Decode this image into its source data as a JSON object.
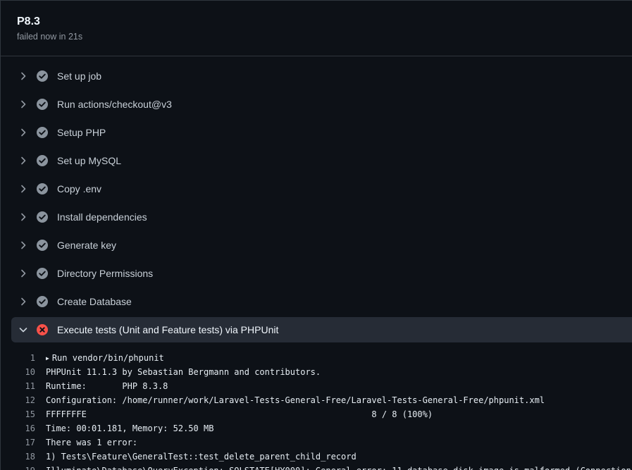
{
  "job": {
    "title": "P8.3",
    "status": "failed now in 21s"
  },
  "colors": {
    "success": "#8b949e",
    "failure": "#f85149",
    "background": "#0d1117",
    "expanded_row": "#262c36"
  },
  "steps": [
    {
      "label": "Set up job",
      "status": "success",
      "icon": "check-circle-icon",
      "expanded": false
    },
    {
      "label": "Run actions/checkout@v3",
      "status": "success",
      "icon": "check-circle-icon",
      "expanded": false
    },
    {
      "label": "Setup PHP",
      "status": "success",
      "icon": "check-circle-icon",
      "expanded": false
    },
    {
      "label": "Set up MySQL",
      "status": "success",
      "icon": "check-circle-icon",
      "expanded": false
    },
    {
      "label": "Copy .env",
      "status": "success",
      "icon": "check-circle-icon",
      "expanded": false
    },
    {
      "label": "Install dependencies",
      "status": "success",
      "icon": "check-circle-icon",
      "expanded": false
    },
    {
      "label": "Generate key",
      "status": "success",
      "icon": "check-circle-icon",
      "expanded": false
    },
    {
      "label": "Directory Permissions",
      "status": "success",
      "icon": "check-circle-icon",
      "expanded": false
    },
    {
      "label": "Create Database",
      "status": "success",
      "icon": "check-circle-icon",
      "expanded": false
    },
    {
      "label": "Execute tests (Unit and Feature tests) via PHPUnit",
      "status": "failure",
      "icon": "x-circle-icon",
      "expanded": true
    }
  ],
  "log": [
    {
      "n": "1",
      "text": "Run vendor/bin/phpunit",
      "collapsible": true
    },
    {
      "n": "10",
      "text": "PHPUnit 11.1.3 by Sebastian Bergmann and contributors."
    },
    {
      "n": "11",
      "text": "Runtime:       PHP 8.3.8"
    },
    {
      "n": "12",
      "text": "Configuration: /home/runner/work/Laravel-Tests-General-Free/Laravel-Tests-General-Free/phpunit.xml"
    },
    {
      "n": "15",
      "text": "FFFFFFFE                                                        8 / 8 (100%)"
    },
    {
      "n": "16",
      "text": "Time: 00:01.181, Memory: 52.50 MB"
    },
    {
      "n": "17",
      "text": "There was 1 error:"
    },
    {
      "n": "18",
      "text": "1) Tests\\Feature\\GeneralTest::test_delete_parent_child_record"
    },
    {
      "n": "19",
      "text": "Illuminate\\Database\\QueryException: SQLSTATE[HY000]: General error: 11 database disk image is malformed (Connection: sqlite, SQL: delete from"
    }
  ]
}
